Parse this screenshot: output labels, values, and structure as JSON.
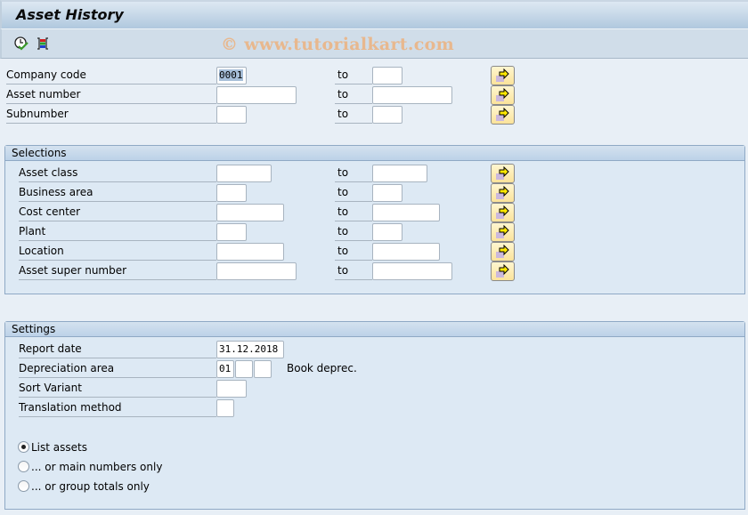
{
  "window": {
    "title": "Asset History"
  },
  "toolbar": {
    "icons": [
      {
        "name": "execute-clock-icon"
      },
      {
        "name": "dynamic-selections-icon"
      }
    ],
    "watermark": "© www.tutorialkart.com"
  },
  "main": {
    "to_label": "to",
    "rows": [
      {
        "label": "Company code",
        "from_value": "0001",
        "to_value": ""
      },
      {
        "label": "Asset number",
        "from_value": "",
        "to_value": ""
      },
      {
        "label": "Subnumber",
        "from_value": "",
        "to_value": ""
      }
    ]
  },
  "selections": {
    "header": "Selections",
    "to_label": "to",
    "rows": [
      {
        "label": "Asset class",
        "from_value": "",
        "to_value": ""
      },
      {
        "label": "Business area",
        "from_value": "",
        "to_value": ""
      },
      {
        "label": "Cost center",
        "from_value": "",
        "to_value": ""
      },
      {
        "label": "Plant",
        "from_value": "",
        "to_value": ""
      },
      {
        "label": "Location",
        "from_value": "",
        "to_value": ""
      },
      {
        "label": "Asset super number",
        "from_value": "",
        "to_value": ""
      }
    ]
  },
  "settings": {
    "header": "Settings",
    "report_date": {
      "label": "Report date",
      "value": "31.12.2018"
    },
    "depreciation_area": {
      "label": "Depreciation area",
      "values": [
        "01",
        "",
        ""
      ],
      "description": "Book deprec."
    },
    "sort_variant": {
      "label": "Sort Variant",
      "value": ""
    },
    "translation_method": {
      "label": "Translation method",
      "value": ""
    },
    "radio_options": [
      {
        "label": "List assets",
        "checked": true
      },
      {
        "label": "... or main numbers only",
        "checked": false
      },
      {
        "label": "... or group totals only",
        "checked": false
      }
    ]
  },
  "colors": {
    "background": "#e8eff6",
    "group_background": "#dde9f4",
    "button_yellow": "#fbe39a",
    "watermark": "#e8b88e"
  }
}
